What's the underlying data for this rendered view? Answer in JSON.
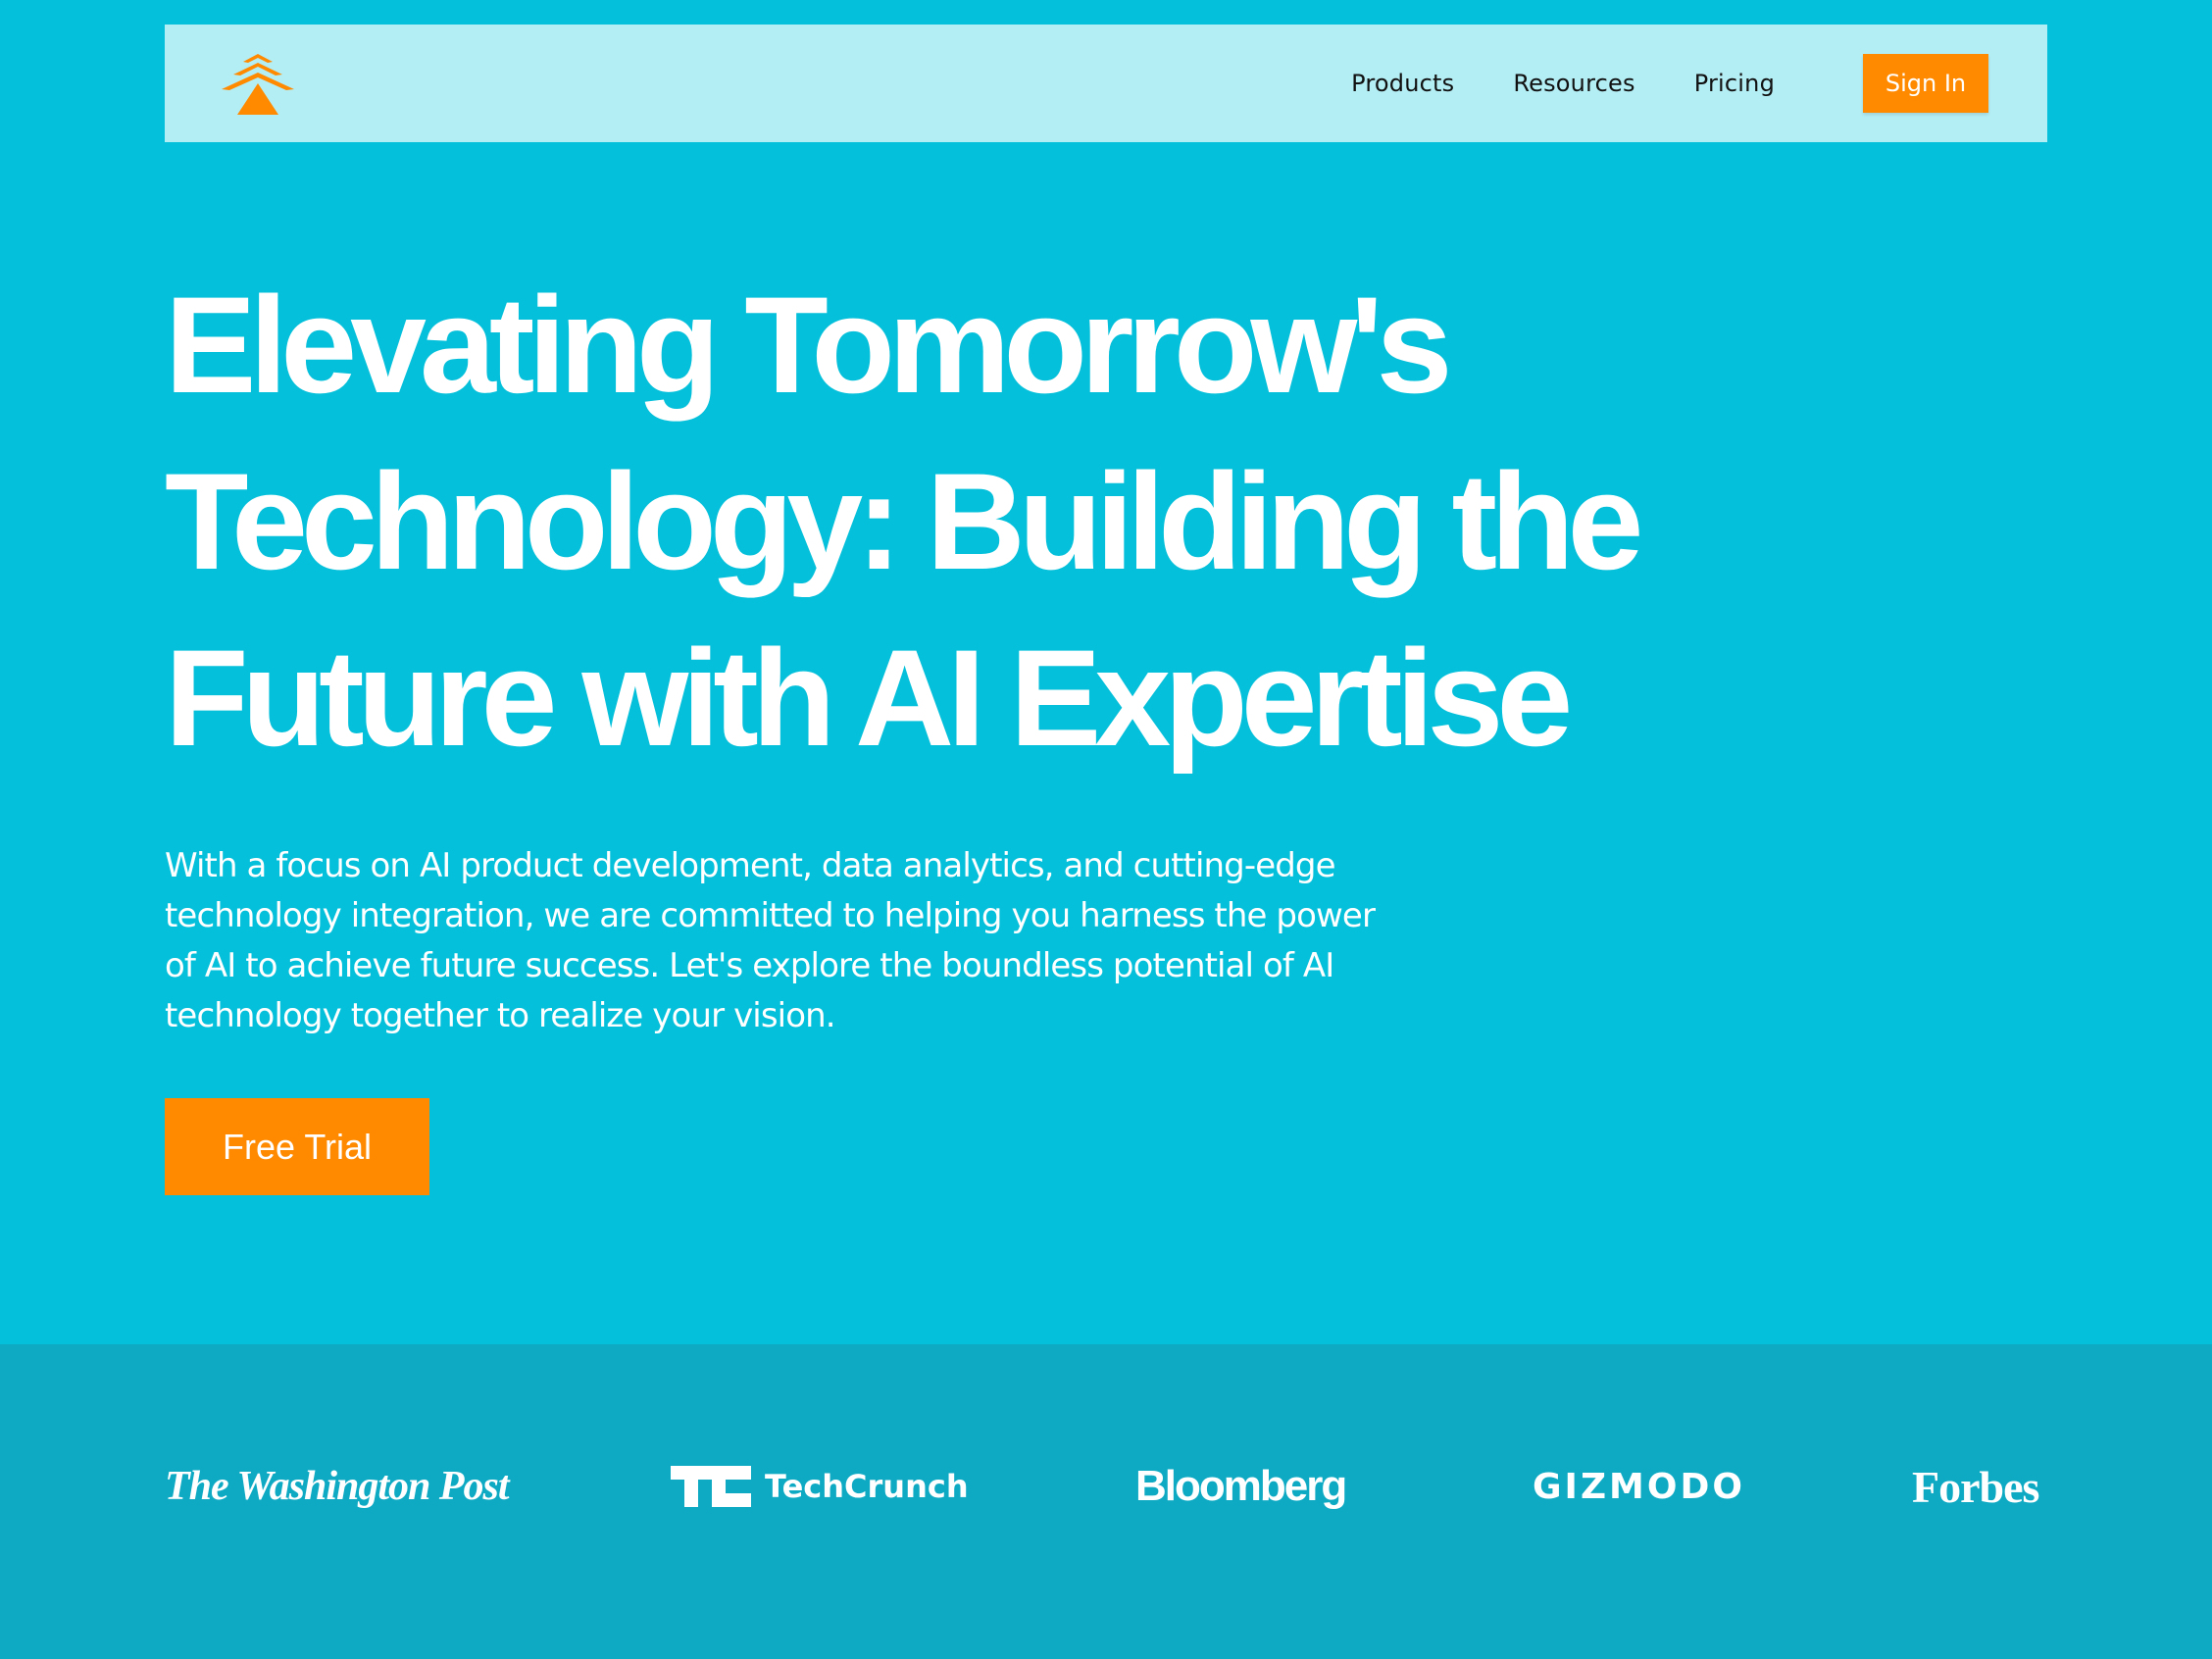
{
  "colors": {
    "hero_background": "#05c0da",
    "nav_background": "#b4eef5",
    "accent": "#ff8a00",
    "press_background": "#0eaac4"
  },
  "nav": {
    "logo_icon": "pine-tree-logo-icon",
    "links": [
      "Products",
      "Resources",
      "Pricing"
    ],
    "signin_label": "Sign In"
  },
  "hero": {
    "headline_lines": [
      "Elevating Tomorrow's",
      "Technology: Building the",
      "Future with AI Expertise"
    ],
    "subtext_lines": [
      "With a focus on AI product development, data analytics, and cutting-edge",
      "technology integration, we are committed to helping you harness the power",
      "of AI to achieve future success. Let's explore the boundless potential of AI",
      "technology together to realize your vision."
    ],
    "cta_label": "Free Trial"
  },
  "press": {
    "logos": [
      "The Washington Post",
      "TechCrunch",
      "Bloomberg",
      "GIZMODO",
      "Forbes"
    ]
  }
}
